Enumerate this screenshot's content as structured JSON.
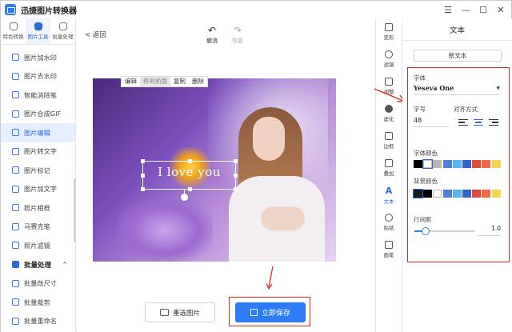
{
  "app": {
    "title": "迅捷图片转换器"
  },
  "window_controls": {
    "menu": "☰",
    "minimize": "—",
    "maximize": "☐",
    "close": "✕"
  },
  "sidebar": {
    "modes": [
      {
        "label": "特色转换"
      },
      {
        "label": "图片工具"
      },
      {
        "label": "批量处理"
      }
    ],
    "items": [
      {
        "label": "图片加水印"
      },
      {
        "label": "图片去水印"
      },
      {
        "label": "智能消除笔"
      },
      {
        "label": "图片合成GIF"
      },
      {
        "label": "图片编辑"
      },
      {
        "label": "图片转文字"
      },
      {
        "label": "图片标记"
      },
      {
        "label": "图片加文字"
      },
      {
        "label": "照片相框"
      },
      {
        "label": "马赛克笔"
      },
      {
        "label": "照片滤镜"
      }
    ],
    "group": {
      "label": "批量处理",
      "chevron": "^"
    },
    "group_items": [
      {
        "label": "批量改尺寸"
      },
      {
        "label": "批量裁剪"
      },
      {
        "label": "批量重命名"
      }
    ]
  },
  "main": {
    "back": "< 返回",
    "undo": "撤消",
    "redo": "恢复",
    "context_menu": [
      "编辑",
      "移到前面",
      "复制",
      "删除"
    ],
    "canvas_text": "I love you",
    "reselect": "重选图片",
    "save": "立即保存"
  },
  "tools": [
    {
      "label": "变形",
      "icon": "crop-icon"
    },
    {
      "label": "滤镜",
      "icon": "filter-icon"
    },
    {
      "label": "调整",
      "icon": "adjust-icon"
    },
    {
      "label": "虚化",
      "icon": "blur-icon"
    },
    {
      "label": "边框",
      "icon": "border-icon"
    },
    {
      "label": "叠加",
      "icon": "overlay-icon"
    },
    {
      "label": "文本",
      "icon": "text-icon"
    },
    {
      "label": "贴纸",
      "icon": "sticker-icon"
    },
    {
      "label": "画笔",
      "icon": "brush-icon"
    }
  ],
  "text_tool_glyph": "A",
  "panel": {
    "title": "文本",
    "new_text": "新文本",
    "font_label": "字体",
    "font_value": "Yeseva One",
    "size_label": "字号",
    "size_value": "48",
    "align_label": "对齐方式",
    "text_color_label": "字体颜色",
    "bg_color_label": "背景颜色",
    "spacing_label": "行间距",
    "spacing_value": "1.0",
    "spacing_level": 0.18,
    "text_colors": [
      "#000000",
      "#ffffff",
      "#b8b8b8",
      "#4f7fe0",
      "#5ab4ee",
      "#3464c8",
      "#e04b3c",
      "#f06a4a",
      "#f2d64b"
    ],
    "bg_colors": [
      "#1a1a1a",
      "#000000",
      "#ffffff",
      "#4f7fe0",
      "#5ab4ee",
      "#3464c8",
      "#e04b3c",
      "#f06a4a",
      "#f2d64b"
    ]
  }
}
